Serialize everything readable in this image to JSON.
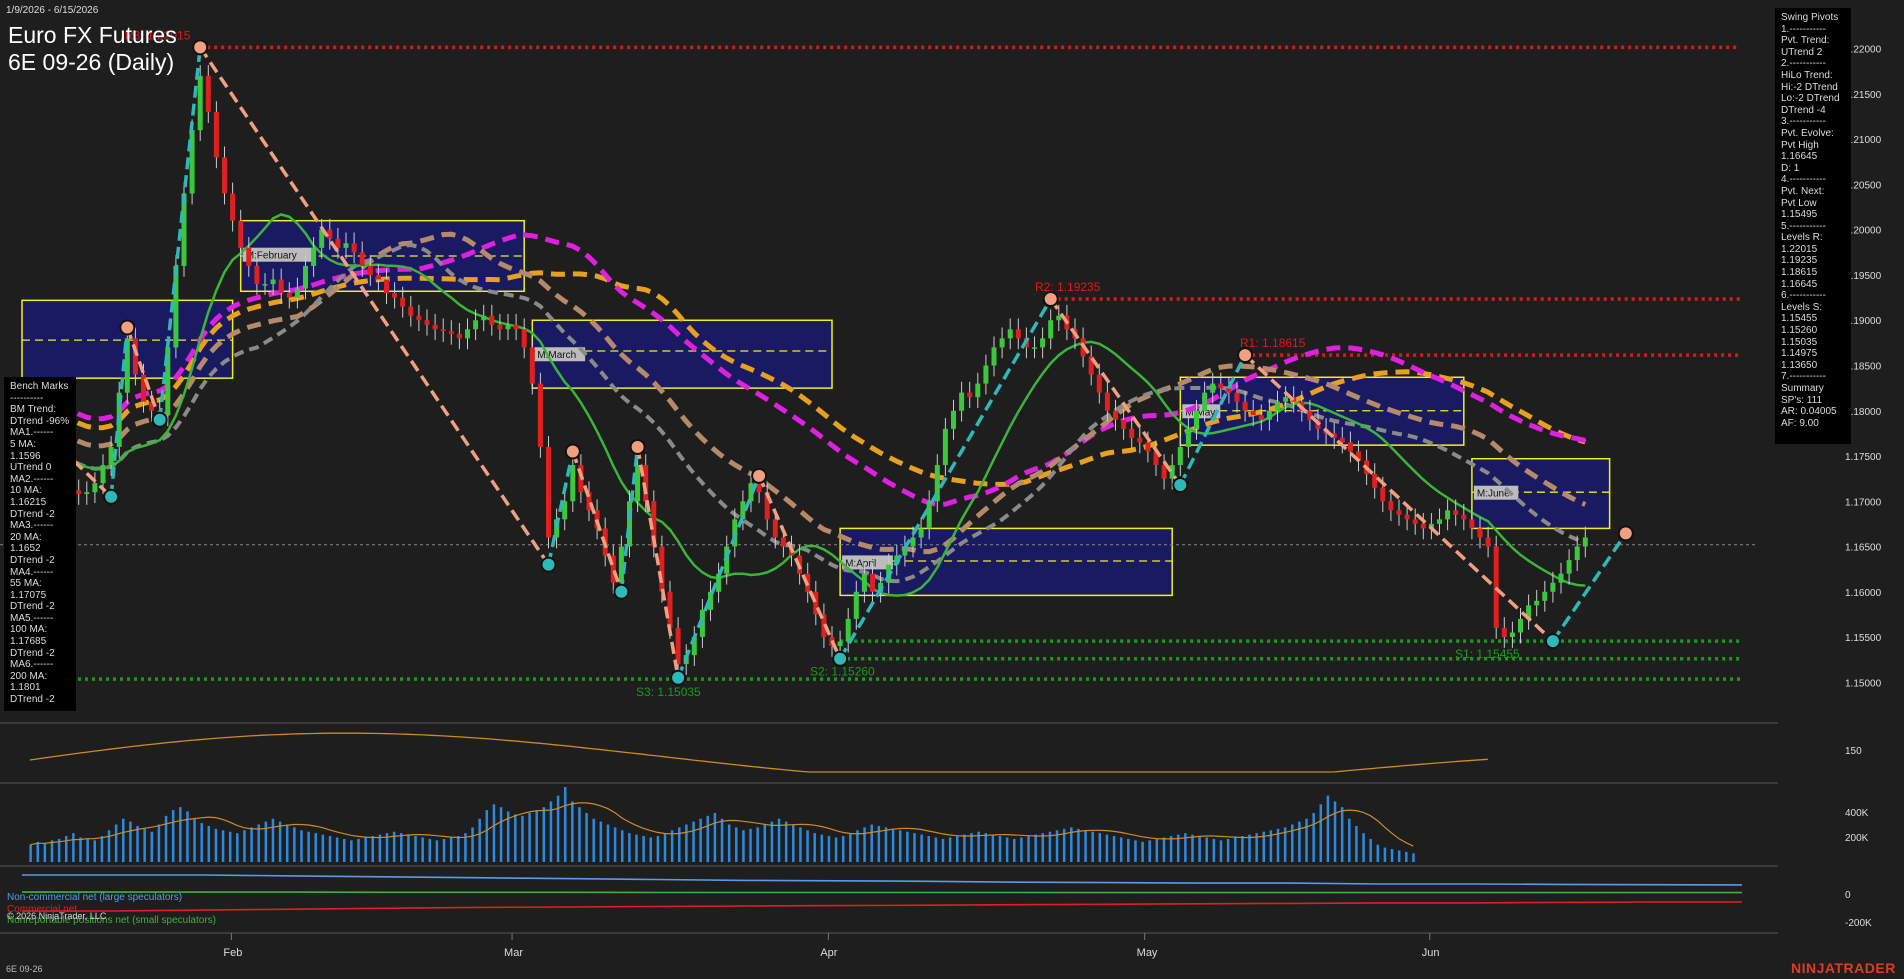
{
  "header": {
    "date_range": "1/9/2026 - 6/15/2026",
    "title_line1": "Euro FX Futures",
    "title_line2": "6E 09-26 (Daily)"
  },
  "bench_panel": {
    "lines": [
      "Bench Marks",
      "----------",
      "BM Trend:",
      "DTrend -96%",
      "MA1.------",
      "5 MA:",
      "1.1596",
      "UTrend 0",
      "MA2.------",
      "10 MA:",
      "1.16215",
      "DTrend -2",
      "MA3.------",
      "20 MA:",
      "1.1652",
      "DTrend -2",
      "MA4.------",
      "55 MA:",
      "1.17075",
      "DTrend -2",
      "MA5.------",
      "100 MA:",
      "1.17685",
      "DTrend -2",
      "MA6.------",
      "200 MA:",
      "1.1801",
      "DTrend -2"
    ]
  },
  "pivot_panel": {
    "lines": [
      "Swing Pivots",
      "1.-----------",
      "Pvt. Trend:",
      "UTrend 2",
      "2.-----------",
      "HiLo Trend:",
      "Hi:-2 DTrend",
      "Lo:-2 DTrend",
      "DTrend -4",
      "3.-----------",
      "Pvt. Evolve:",
      "Pvt High",
      "1.16645",
      "D: 1",
      "4.-----------",
      "Pvt. Next:",
      "Pvt Low",
      "1.15495",
      "5.-----------",
      "Levels R:",
      "1.22015",
      "1.19235",
      "1.18615",
      "1.16645",
      "6.-----------",
      "Levels S:",
      "1.15455",
      "1.15260",
      "1.15035",
      "1.14975",
      "1.13650",
      "7.-----------",
      "Summary",
      "SP's: 111",
      "AR: 0.04005",
      "AF: 9.00"
    ]
  },
  "footer": {
    "symbol": "6E 09-26",
    "copyright": "© 2026 NinjaTrader, LLC",
    "brand": "NINJATRADER"
  },
  "cot_labels": {
    "large": "Non-commercial net (large speculators)",
    "commercial": "Commercial net",
    "small": "Nonreportable positions net (small speculators)"
  },
  "colors": {
    "background": "#1e1e1e",
    "up_candle": "#3cc83c",
    "down_candle": "#e02020",
    "resistance": "#e01818",
    "support": "#1a9a1a",
    "ma_green": "#3ab53a",
    "ma_gray": "#8a8a8a",
    "ma_tan": "#b58a6a",
    "ma_magenta": "#e020e0",
    "ma_orange": "#e8a020",
    "swing_up": "#2fb8b8",
    "swing_down": "#f0a080",
    "month_box": "#1a1a70",
    "month_box_border": "#f0f020"
  },
  "chart_data": {
    "type": "candlestick",
    "title": "Euro FX Futures 6E 09-26 (Daily)",
    "x_tick_labels": [
      "Feb",
      "Mar",
      "Apr",
      "May",
      "Jun"
    ],
    "price_axis": {
      "ticks": [
        "1.22000",
        "1.21500",
        "1.21000",
        "1.20500",
        "1.20000",
        "1.19500",
        "1.19000",
        "1.18500",
        "1.18000",
        "1.17500",
        "1.17000",
        "1.16500",
        "1.16000",
        "1.15500",
        "1.15000"
      ],
      "ylim": [
        1.1455,
        1.2245
      ]
    },
    "levels": [
      {
        "label": "R3: 1.22015",
        "price": 1.22015,
        "kind": "resistance"
      },
      {
        "label": "R2: 1.19235",
        "price": 1.19235,
        "kind": "resistance"
      },
      {
        "label": "R1: 1.18615",
        "price": 1.18615,
        "kind": "resistance"
      },
      {
        "label": "S1: 1.15455",
        "price": 1.15455,
        "kind": "support"
      },
      {
        "label": "S2: 1.15260",
        "price": 1.1526,
        "kind": "support"
      },
      {
        "label": "S3: 1.15035",
        "price": 1.15035,
        "kind": "support"
      }
    ],
    "month_boxes": [
      {
        "label": "",
        "start": 0,
        "end": 26,
        "low": 1.1836,
        "high": 1.1922,
        "mid": 1.1878
      },
      {
        "label": "M:February",
        "start": 27,
        "end": 62,
        "low": 1.1932,
        "high": 1.201,
        "mid": 1.1971
      },
      {
        "label": "M:March",
        "start": 63,
        "end": 100,
        "low": 1.1825,
        "high": 1.19,
        "mid": 1.1866
      },
      {
        "label": "M:April",
        "start": 101,
        "end": 142,
        "low": 1.1596,
        "high": 1.167,
        "mid": 1.1634
      },
      {
        "label": "M:May",
        "start": 143,
        "end": 178,
        "low": 1.1762,
        "high": 1.1837,
        "mid": 1.18
      },
      {
        "label": "M:June",
        "start": 179,
        "end": 196,
        "low": 1.167,
        "high": 1.1747,
        "mid": 1.171
      }
    ],
    "swing_path": [
      {
        "i": 0,
        "p": 1.18
      },
      {
        "i": 11,
        "p": 1.1705
      },
      {
        "i": 13,
        "p": 1.1892
      },
      {
        "i": 17,
        "p": 1.179
      },
      {
        "i": 22,
        "p": 1.22015
      },
      {
        "i": 65,
        "p": 1.163
      },
      {
        "i": 68,
        "p": 1.1755
      },
      {
        "i": 74,
        "p": 1.16
      },
      {
        "i": 76,
        "p": 1.176
      },
      {
        "i": 81,
        "p": 1.1505
      },
      {
        "i": 91,
        "p": 1.1728
      },
      {
        "i": 101,
        "p": 1.1526
      },
      {
        "i": 127,
        "p": 1.19235
      },
      {
        "i": 143,
        "p": 1.1718
      },
      {
        "i": 151,
        "p": 1.18615
      },
      {
        "i": 189,
        "p": 1.15455
      },
      {
        "i": 198,
        "p": 1.16645
      }
    ],
    "closes": [
      1.178,
      1.1775,
      1.176,
      1.1745,
      1.173,
      1.172,
      1.1712,
      1.1708,
      1.171,
      1.172,
      1.174,
      1.176,
      1.182,
      1.188,
      1.184,
      1.181,
      1.18,
      1.1795,
      1.187,
      1.196,
      1.204,
      1.211,
      1.217,
      1.213,
      1.208,
      1.204,
      1.201,
      1.198,
      1.196,
      1.194,
      1.194,
      1.1945,
      1.193,
      1.1925,
      1.1935,
      1.196,
      1.198,
      1.2,
      1.199,
      1.198,
      1.1985,
      1.1975,
      1.196,
      1.195,
      1.1945,
      1.193,
      1.1925,
      1.1915,
      1.1905,
      1.19,
      1.1895,
      1.189,
      1.1888,
      1.1885,
      1.188,
      1.189,
      1.19,
      1.1905,
      1.1895,
      1.189,
      1.1895,
      1.189,
      1.187,
      1.183,
      1.176,
      1.166,
      1.168,
      1.17,
      1.174,
      1.171,
      1.169,
      1.167,
      1.164,
      1.161,
      1.165,
      1.17,
      1.174,
      1.17,
      1.165,
      1.16,
      1.156,
      1.152,
      1.153,
      1.155,
      1.158,
      1.16,
      1.162,
      1.165,
      1.168,
      1.17,
      1.172,
      1.171,
      1.168,
      1.166,
      1.165,
      1.164,
      1.162,
      1.16,
      1.1575,
      1.155,
      1.154,
      1.1545,
      1.157,
      1.16,
      1.162,
      1.16,
      1.161,
      1.163,
      1.164,
      1.165,
      1.166,
      1.167,
      1.17,
      1.174,
      1.178,
      1.18,
      1.182,
      1.1815,
      1.183,
      1.185,
      1.187,
      1.188,
      1.189,
      1.188,
      1.187,
      1.187,
      1.188,
      1.19,
      1.1905,
      1.189,
      1.188,
      1.186,
      1.184,
      1.182,
      1.18,
      1.179,
      1.178,
      1.177,
      1.1765,
      1.1755,
      1.174,
      1.1725,
      1.174,
      1.176,
      1.178,
      1.18,
      1.182,
      1.183,
      1.1825,
      1.182,
      1.181,
      1.18,
      1.1795,
      1.179,
      1.18,
      1.181,
      1.1815,
      1.181,
      1.18,
      1.179,
      1.178,
      1.1775,
      1.177,
      1.1765,
      1.1755,
      1.1745,
      1.173,
      1.1715,
      1.17,
      1.169,
      1.1685,
      1.168,
      1.1675,
      1.167,
      1.1675,
      1.168,
      1.169,
      1.1685,
      1.168,
      1.167,
      1.166,
      1.165,
      1.156,
      1.155,
      1.1555,
      1.157,
      1.1585,
      1.159,
      1.16,
      1.161,
      1.162,
      1.1635,
      1.165,
      1.166
    ],
    "volume": [
      120,
      140,
      130,
      150,
      160,
      180,
      200,
      170,
      160,
      150,
      180,
      220,
      260,
      300,
      280,
      250,
      230,
      210,
      260,
      320,
      360,
      380,
      350,
      300,
      270,
      250,
      230,
      220,
      210,
      200,
      220,
      240,
      260,
      280,
      300,
      280,
      260,
      240,
      220,
      210,
      200,
      190,
      180,
      170,
      160,
      150,
      160,
      170,
      180,
      190,
      200,
      210,
      200,
      190,
      180,
      170,
      160,
      150,
      160,
      170,
      180,
      200,
      240,
      300,
      360,
      400,
      380,
      350,
      330,
      320,
      340,
      360,
      380,
      420,
      460,
      520,
      420,
      380,
      340,
      300,
      280,
      260,
      240,
      220,
      200,
      190,
      180,
      170,
      180,
      200,
      220,
      240,
      260,
      280,
      300,
      320,
      340,
      300,
      260,
      240,
      220,
      230,
      240,
      260,
      280,
      300,
      280,
      260,
      240,
      220,
      200,
      190,
      180,
      170,
      180,
      200,
      220,
      240,
      260,
      250,
      240,
      230,
      220,
      210,
      200,
      190,
      180,
      170,
      160,
      170,
      180,
      190,
      200,
      210,
      200,
      190,
      180,
      170,
      160,
      170,
      180,
      190,
      200,
      210,
      220,
      230,
      240,
      230,
      220,
      210,
      200,
      190,
      180,
      170,
      160,
      150,
      140,
      150,
      160,
      170,
      180,
      190,
      200,
      190,
      180,
      170,
      160,
      150,
      160,
      170,
      180,
      190,
      200,
      210,
      220,
      230,
      240,
      260,
      280,
      300,
      340,
      400,
      460,
      420,
      380,
      300,
      250,
      200,
      160,
      120,
      100,
      90,
      80,
      70,
      60
    ],
    "cot": {
      "large": [
        1,
        1,
        1,
        0.95,
        0.9,
        0.85,
        0.8,
        0.75,
        0.7,
        0.68,
        0.65,
        0.6,
        0.58,
        0.55,
        0.55,
        0.5,
        0.5,
        0.48,
        0.46,
        0.45
      ],
      "commercial": [
        -1,
        -1,
        -0.95,
        -0.9,
        -0.85,
        -0.8,
        -0.78,
        -0.75,
        -0.72,
        -0.7,
        -0.68,
        -0.65,
        -0.63,
        -0.6,
        -0.58,
        -0.55,
        -0.55,
        -0.52,
        -0.5,
        -0.5
      ],
      "small": [
        0.05,
        0.05,
        0.05,
        0.05,
        0.04,
        0.04,
        0.04,
        0.03,
        0.03,
        0.03,
        0.03,
        0.03,
        0.02,
        0.02,
        0.02,
        0.02,
        0.02,
        0.02,
        0.02,
        0.02
      ]
    },
    "oscillator_tick": "150",
    "volume_ticks": [
      "400K",
      "200K"
    ],
    "cot_ticks": [
      "0",
      "-200K"
    ]
  }
}
